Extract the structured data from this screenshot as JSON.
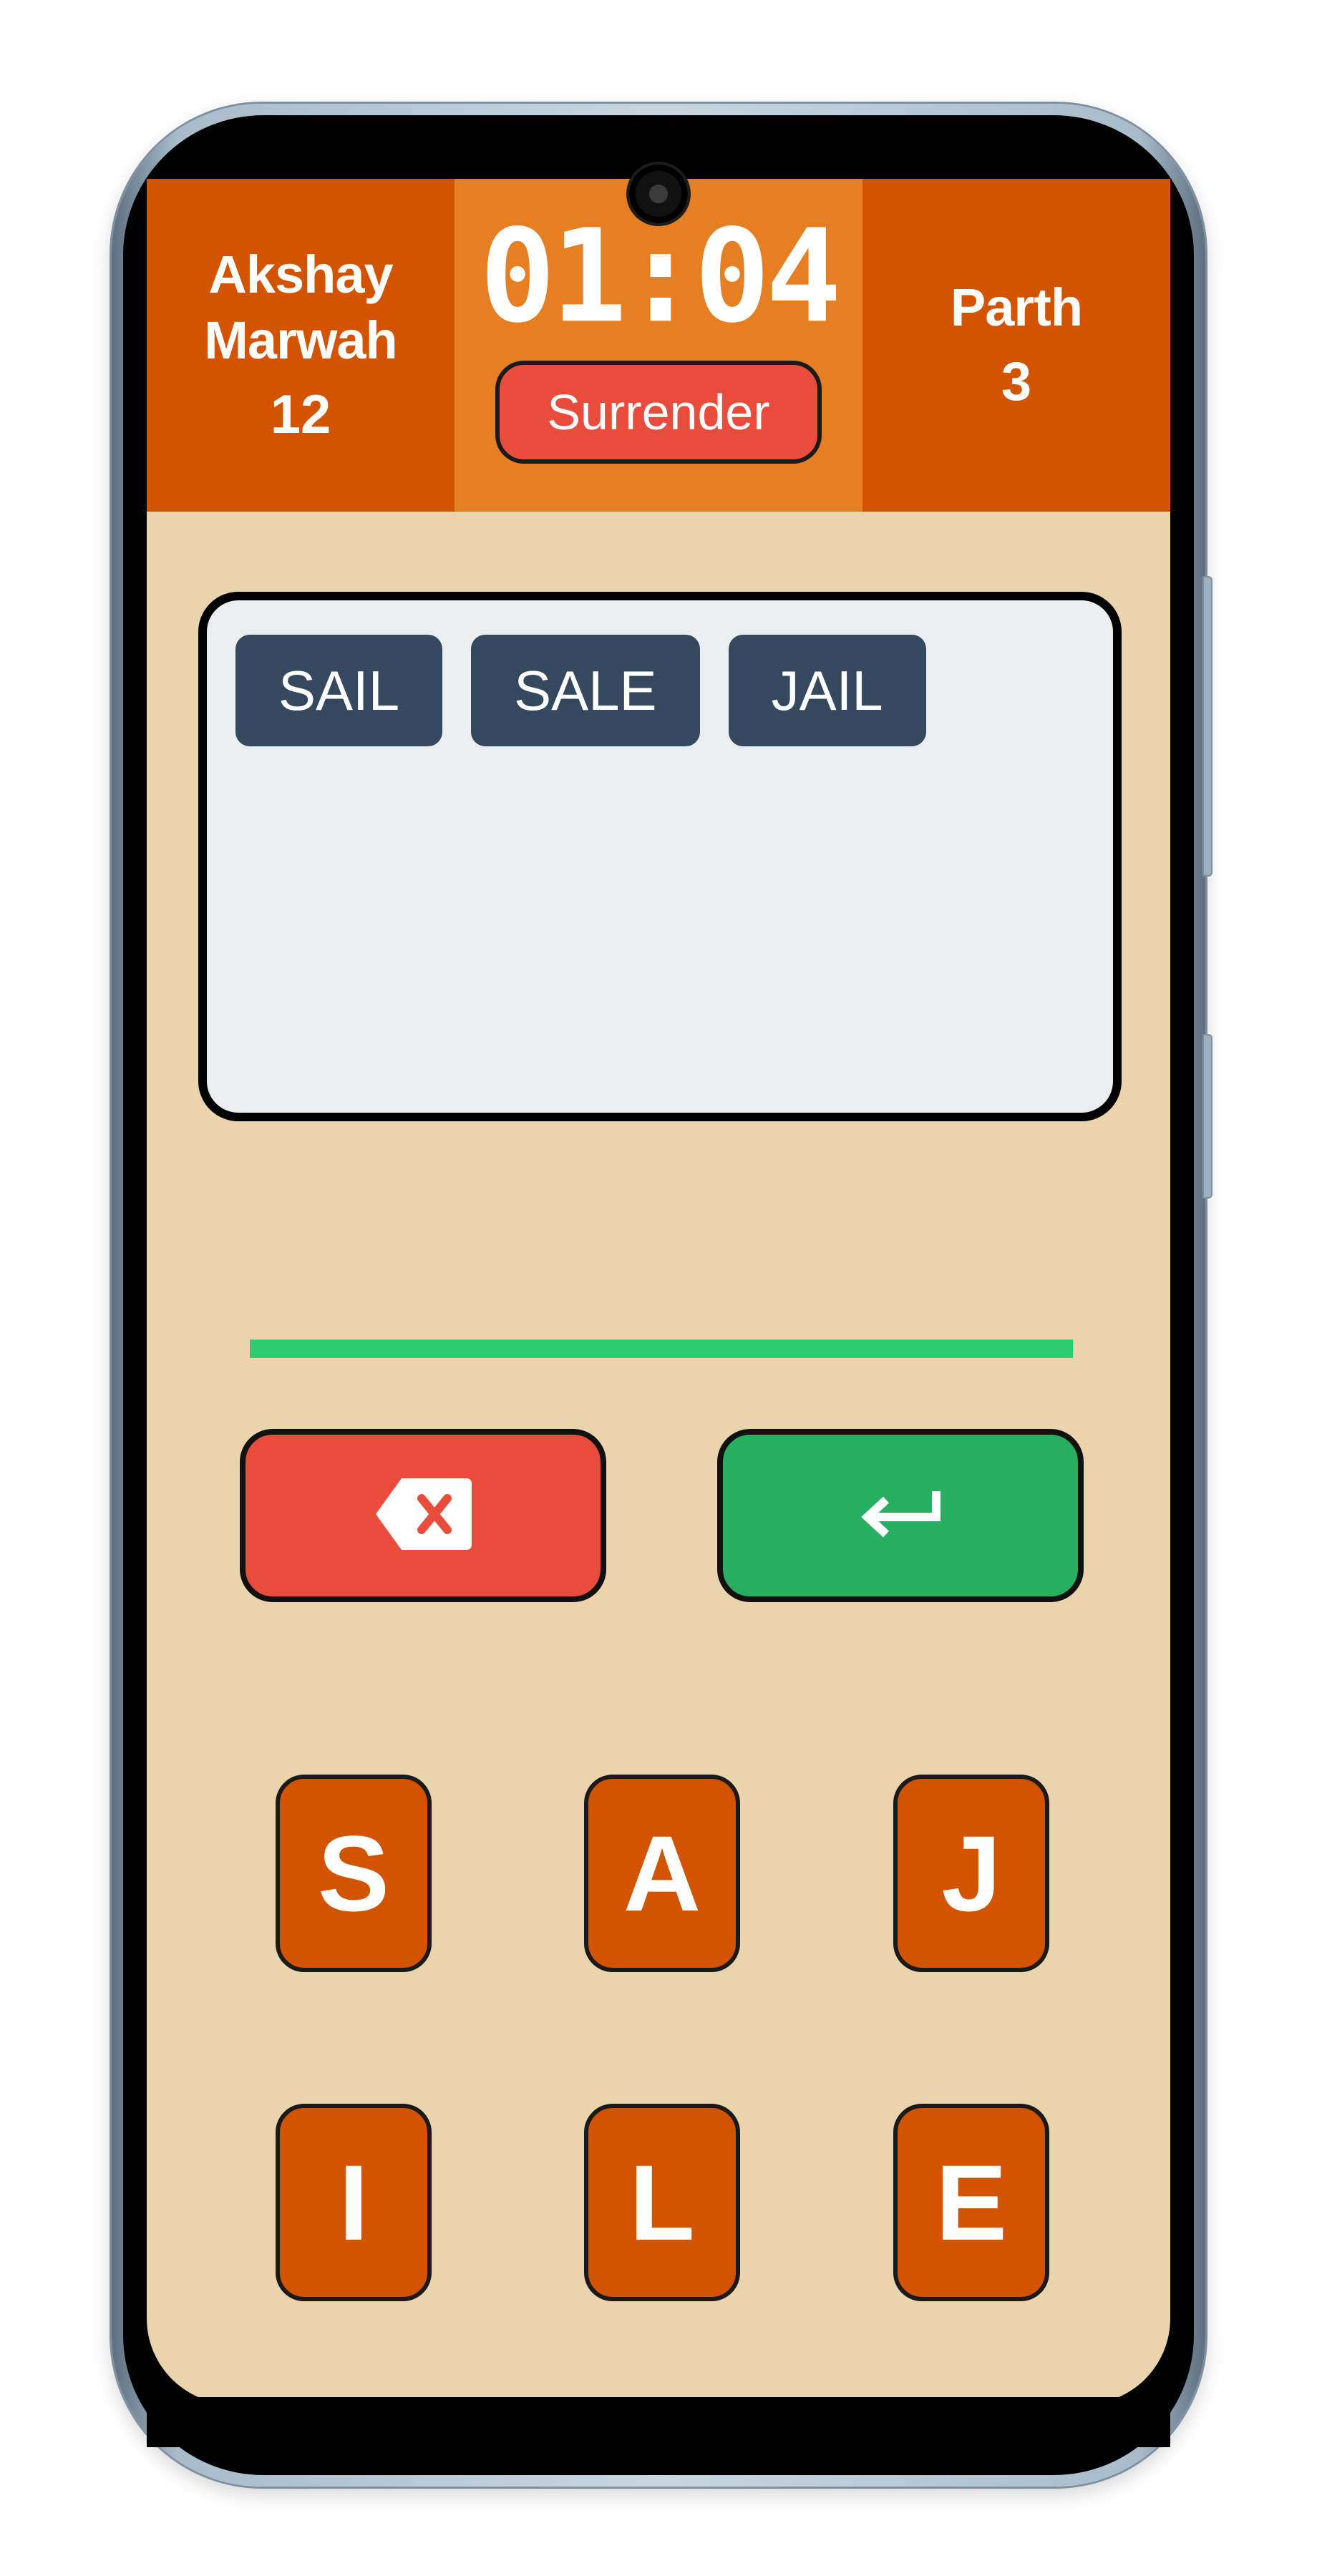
{
  "header": {
    "player_left": {
      "name": "Akshay Marwah",
      "score": "12"
    },
    "timer": "01:04",
    "surrender_label": "Surrender",
    "player_right": {
      "name": "Parth",
      "score": "3"
    }
  },
  "found_words": [
    "SAIL",
    "SALE",
    "JAIL"
  ],
  "input": {
    "progress_fraction": 1.0
  },
  "actions": {
    "backspace_icon": "backspace-icon",
    "enter_icon": "enter-icon"
  },
  "tiles": [
    "S",
    "A",
    "J",
    "I",
    "L",
    "E"
  ],
  "colors": {
    "header_player": "#d35400",
    "header_timer": "#e67e22",
    "surrender": "#e74c3c",
    "background": "#ead4ae",
    "word_chip": "#34495e",
    "progress": "#2ecc71",
    "backspace": "#e74c3c",
    "enter": "#27ae60",
    "tile": "#d35400"
  }
}
